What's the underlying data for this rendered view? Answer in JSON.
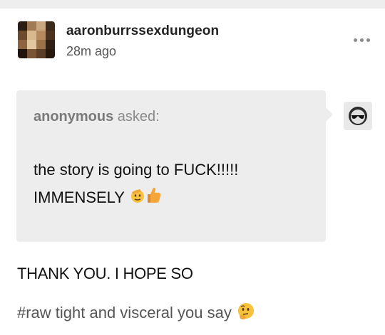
{
  "post": {
    "blog_name": "aaronburrssexdungeon",
    "timestamp": "28m ago",
    "more_icon": "more-horizontal-icon"
  },
  "ask": {
    "asker": "anonymous",
    "asked_label": " asked:",
    "question_line1": "the story is going to FUCK!!!!!",
    "question_line2": "IMMENSELY",
    "emojis": [
      "saluting-face-emoji",
      "thumbs-up-emoji"
    ],
    "asker_avatar_icon": "anonymous-sunglasses-icon"
  },
  "answer": {
    "text": "THANK YOU. I HOPE SO"
  },
  "tags": [
    {
      "text": "#raw tight and visceral you say",
      "emoji": "thinking-face-emoji"
    }
  ],
  "colors": {
    "top_strip": "#eeeeee",
    "ask_background": "#ededed",
    "text_primary": "#111111",
    "text_muted": "#8a8a8a"
  }
}
